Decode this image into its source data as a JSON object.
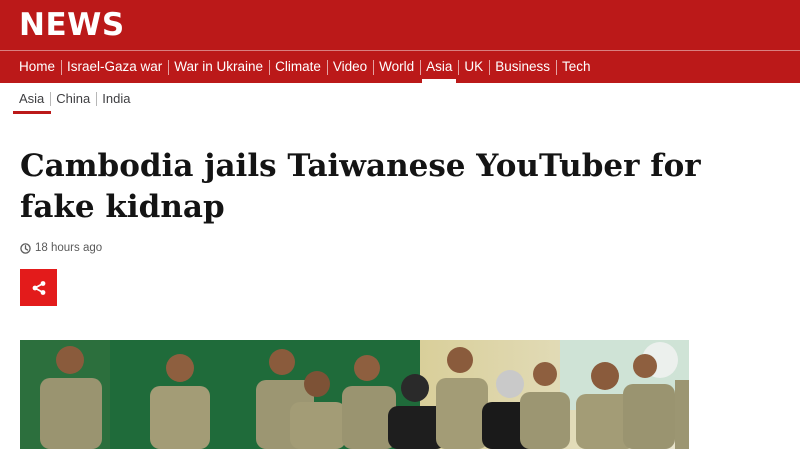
{
  "masthead": {
    "logo": "NEWS",
    "nav": [
      {
        "label": "Home"
      },
      {
        "label": "Israel-Gaza war"
      },
      {
        "label": "War in Ukraine"
      },
      {
        "label": "Climate"
      },
      {
        "label": "Video"
      },
      {
        "label": "World"
      },
      {
        "label": "Asia",
        "active": true
      },
      {
        "label": "UK"
      },
      {
        "label": "Business"
      },
      {
        "label": "Tech"
      }
    ]
  },
  "subnav": {
    "items": [
      {
        "label": "Asia",
        "active": true
      },
      {
        "label": "China"
      },
      {
        "label": "India"
      }
    ]
  },
  "article": {
    "headline": "Cambodia jails Taiwanese YouTuber for fake kidnap",
    "timestamp": "18 hours ago",
    "share_icon": "share-icon",
    "clock_icon": "clock-icon"
  },
  "colors": {
    "brand_red": "#bb1919",
    "share_red": "#e31b1b",
    "headline_text": "#141414"
  }
}
